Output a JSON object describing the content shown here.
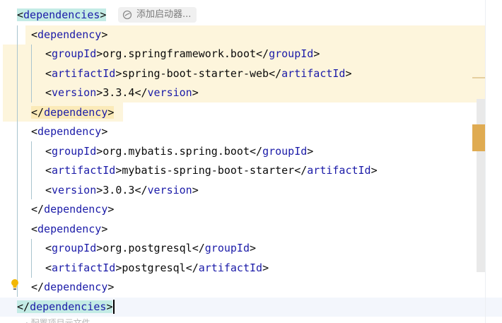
{
  "editor": {
    "lines": [
      {
        "indent": 0,
        "kind": "open",
        "tag": "dependencies",
        "match": "cyan"
      },
      {
        "indent": 1,
        "kind": "open",
        "tag": "dependency"
      },
      {
        "indent": 2,
        "kind": "elem",
        "tag": "groupId",
        "value": "org.springframework.boot"
      },
      {
        "indent": 2,
        "kind": "elem",
        "tag": "artifactId",
        "value": "spring-boot-starter-web"
      },
      {
        "indent": 2,
        "kind": "elem",
        "tag": "version",
        "value": "3.3.4"
      },
      {
        "indent": 1,
        "kind": "close",
        "tag": "dependency",
        "match": "yellow"
      },
      {
        "indent": 1,
        "kind": "open",
        "tag": "dependency"
      },
      {
        "indent": 2,
        "kind": "elem",
        "tag": "groupId",
        "value": "org.mybatis.spring.boot"
      },
      {
        "indent": 2,
        "kind": "elem",
        "tag": "artifactId",
        "value": "mybatis-spring-boot-starter"
      },
      {
        "indent": 2,
        "kind": "elem",
        "tag": "version",
        "value": "3.0.3"
      },
      {
        "indent": 1,
        "kind": "close",
        "tag": "dependency"
      },
      {
        "indent": 1,
        "kind": "open",
        "tag": "dependency"
      },
      {
        "indent": 2,
        "kind": "elem",
        "tag": "groupId",
        "value": "org.postgresql"
      },
      {
        "indent": 2,
        "kind": "elem",
        "tag": "artifactId",
        "value": "postgresql"
      },
      {
        "indent": 1,
        "kind": "close",
        "tag": "dependency"
      },
      {
        "indent": 0,
        "kind": "close",
        "tag": "dependencies",
        "match": "cyan",
        "caret": true
      }
    ]
  },
  "inlay_hint": {
    "label": "添加启动器...",
    "icon": "starter-icon"
  },
  "gutter": {
    "bulb_icon": "lightbulb-icon"
  },
  "footer_hint": "· 配置项目元文件",
  "colors": {
    "tag": "#1b1ba8",
    "text": "#0a0a0a",
    "block_highlight": "#fdf5dc",
    "tag_match": "#c3ebe5",
    "scroll_marker": "#dfab52"
  }
}
